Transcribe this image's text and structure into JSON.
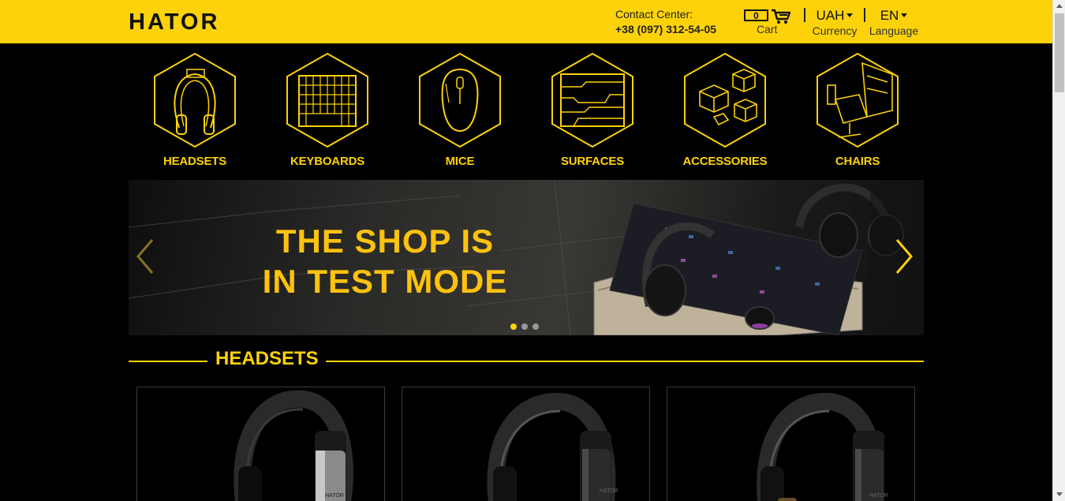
{
  "header": {
    "logo_text": "HATOR",
    "contact_label": "Contact Center:",
    "phone": "+38 (097) 312-54-05",
    "cart_count": "0",
    "cart_label": "Cart",
    "currency_value": "UAH",
    "currency_label": "Currency",
    "language_value": "EN",
    "language_label": "Language"
  },
  "categories": [
    {
      "label": "HEADSETS",
      "icon": "headset-icon"
    },
    {
      "label": "KEYBOARDS",
      "icon": "keyboard-icon"
    },
    {
      "label": "MICE",
      "icon": "mouse-icon"
    },
    {
      "label": "SURFACES",
      "icon": "mousepad-icon"
    },
    {
      "label": "ACCESSORIES",
      "icon": "keycaps-icon"
    },
    {
      "label": "CHAIRS",
      "icon": "chair-icon"
    }
  ],
  "banner": {
    "line1": "THE SHOP IS",
    "line2": "IN TEST MODE",
    "slide_count": 3,
    "active_slide": 1
  },
  "section": {
    "title": "HEADSETS"
  },
  "products": [
    {
      "brand_mark": "HATOR"
    },
    {
      "brand_mark": "HATOR"
    },
    {
      "brand_mark": "HATOR"
    }
  ],
  "colors": {
    "brand_yellow": "#fdd20a",
    "background": "#000000"
  }
}
